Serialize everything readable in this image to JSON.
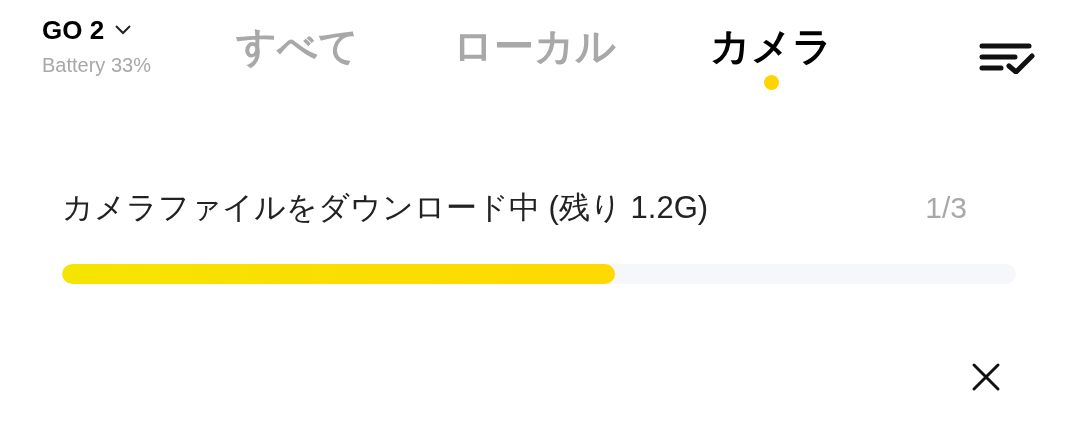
{
  "device": {
    "name": "GO 2",
    "battery": "Battery 33%"
  },
  "tabs": [
    {
      "label": "すべて",
      "selected": false
    },
    {
      "label": "ローカル",
      "selected": false
    },
    {
      "label": "カメラ",
      "selected": true
    }
  ],
  "download": {
    "message": "カメラファイルをダウンロード中 (残り 1.2G)",
    "count": "1/3",
    "level": 0.58
  }
}
